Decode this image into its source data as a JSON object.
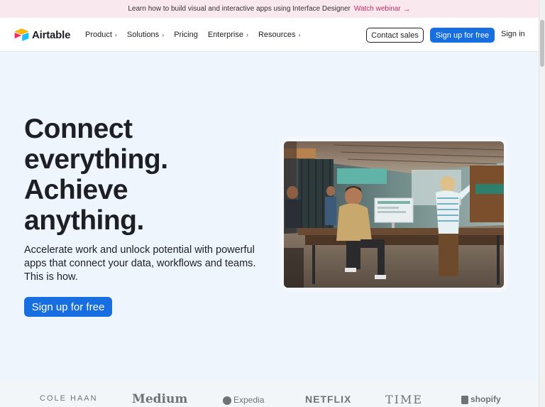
{
  "banner": {
    "text": "Learn how to build visual and interactive apps using Interface Designer",
    "link": "Watch webinar",
    "arrow": "→"
  },
  "nav": {
    "brand": "Airtable",
    "items": [
      {
        "label": "Product",
        "chevron": "›"
      },
      {
        "label": "Solutions",
        "chevron": "›"
      },
      {
        "label": "Pricing",
        "chevron": ""
      },
      {
        "label": "Enterprise",
        "chevron": "›"
      },
      {
        "label": "Resources",
        "chevron": "›"
      }
    ],
    "contact_sales": "Contact sales",
    "signup": "Sign up for free",
    "signin": "Sign in"
  },
  "hero": {
    "headline": [
      "Connect",
      "everything.",
      "Achieve",
      "anything."
    ],
    "subtext": "Accelerate work and unlock potential with powerful apps that connect your data, workflows and teams. This is how.",
    "cta": "Sign up for free"
  },
  "customer_logos": [
    "COLE HAAN",
    "Medium",
    "Expedia",
    "NETFLIX",
    "TIME",
    "shopify"
  ],
  "colors": {
    "accent": "#166ee1",
    "banner_bg": "#f9e9ee",
    "banner_link": "#c32f5e",
    "hero_bg": "#eef5fc"
  }
}
